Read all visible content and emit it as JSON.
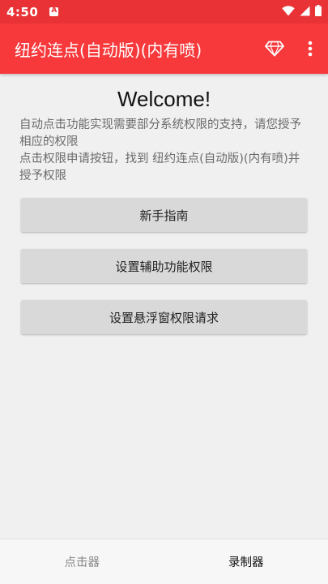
{
  "status_bar": {
    "time": "4:50"
  },
  "app_bar": {
    "title": "纽约连点(自动版)(内有喷)"
  },
  "main": {
    "welcome": "Welcome!",
    "description_line1": "自动点击功能实现需要部分系统权限的支持，请您授予相应的权限",
    "description_line2": "点击权限申请按钮，找到 纽约连点(自动版)(内有喷)并授予权限",
    "buttons": [
      {
        "label": "新手指南"
      },
      {
        "label": "设置辅助功能权限"
      },
      {
        "label": "设置悬浮窗权限请求"
      }
    ]
  },
  "bottom_nav": {
    "tabs": [
      {
        "label": "点击器",
        "active": false
      },
      {
        "label": "录制器",
        "active": true
      }
    ]
  },
  "colors": {
    "status_bar": "#e83236",
    "app_bar": "#f7393c",
    "background": "#f0f0f0",
    "button": "#d9d9d9"
  }
}
